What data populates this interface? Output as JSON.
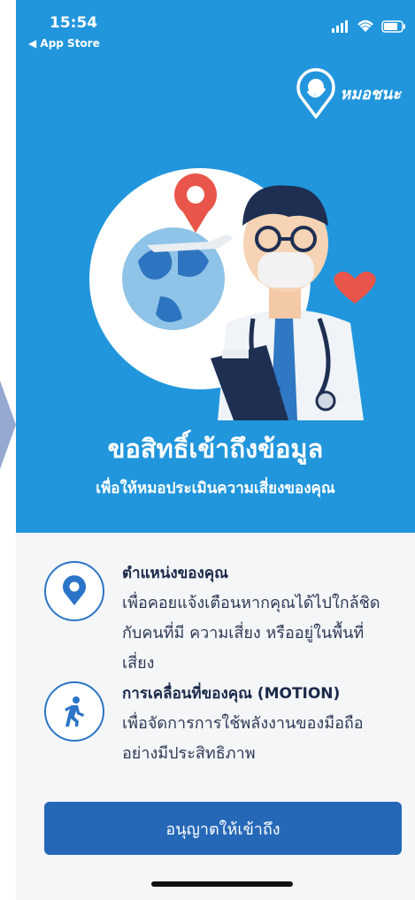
{
  "status_bar": {
    "time": "15:54",
    "back_label": "◀ App Store"
  },
  "app": {
    "logo_text": "หมอชนะ"
  },
  "hero": {
    "title": "ขอสิทธิ์เข้าถึงข้อมูล",
    "subtitle": "เพื่อให้หมอประเมินความเสี่ยงของคุณ"
  },
  "permissions": [
    {
      "icon": "location-pin-icon",
      "title": "ตำแหน่งของคุณ",
      "lines": [
        "เพื่อคอยแจ้งเตือนหากคุณได้ไปใกล้ชิด",
        "กับคนที่มี ความเสี่ยง หรืออยู่ในพื้นที่",
        "เสี่ยง"
      ]
    },
    {
      "icon": "walking-person-icon",
      "title": "การเคลื่อนที่ของคุณ (MOTION)",
      "lines": [
        "เพื่อจัดการการใช้พลังงานของมือถือ",
        "อย่างมีประสิทธิภาพ"
      ]
    }
  ],
  "primary_button": {
    "label": "อนุญาตให้เข้าถึง"
  },
  "colors": {
    "hero_bg": "#2196dc",
    "button_bg": "#2668b8",
    "icon_stroke": "#2b74c7"
  }
}
